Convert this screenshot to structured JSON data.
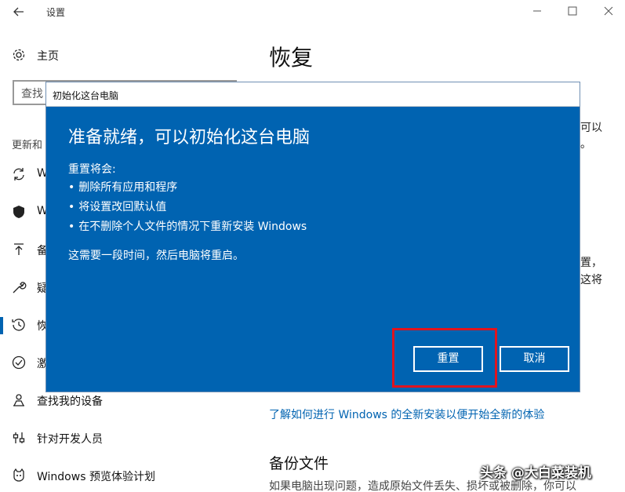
{
  "window": {
    "title": "设置"
  },
  "sidebar": {
    "home_label": "主页",
    "search_placeholder": "查找",
    "section_label": "更新和",
    "items": [
      {
        "label": "W",
        "icon": "sync-icon"
      },
      {
        "label": "W",
        "icon": "shield-icon"
      },
      {
        "label": "备",
        "icon": "backup-arrow-icon"
      },
      {
        "label": "疑",
        "icon": "wrench-icon"
      },
      {
        "label": "恢",
        "icon": "history-icon"
      },
      {
        "label": "激",
        "icon": "check-circle-icon"
      },
      {
        "label": "查找我的设备",
        "icon": "person-location-icon"
      },
      {
        "label": "针对开发人员",
        "icon": "dev-settings-icon"
      },
      {
        "label": "Windows 预览体验计划",
        "icon": "cat-icon"
      }
    ]
  },
  "main": {
    "title": "恢复",
    "fragments": {
      "f1": "可以",
      "f2": "。",
      "f3": "置，",
      "f4": "这将"
    },
    "link": "了解如何进行 Windows 的全新安装以便开始全新的体验",
    "backup_title": "备份文件",
    "backup_desc": "如果电脑出现问题，造成原始文件丢失、损坏或被删除，你可以"
  },
  "dialog": {
    "title": "初始化这台电脑",
    "heading": "准备就绪，可以初始化这台电脑",
    "intro": "重置将会:",
    "bullets": [
      "删除所有应用和程序",
      "将设置改回默认值",
      "在不删除个人文件的情况下重新安装 Windows"
    ],
    "note": "这需要一段时间，然后电脑将重启。",
    "reset_button": "重置",
    "cancel_button": "取消"
  },
  "watermark": "头条 @大白菜装机",
  "colors": {
    "accent": "#0063b1",
    "highlight": "#e0141e"
  }
}
